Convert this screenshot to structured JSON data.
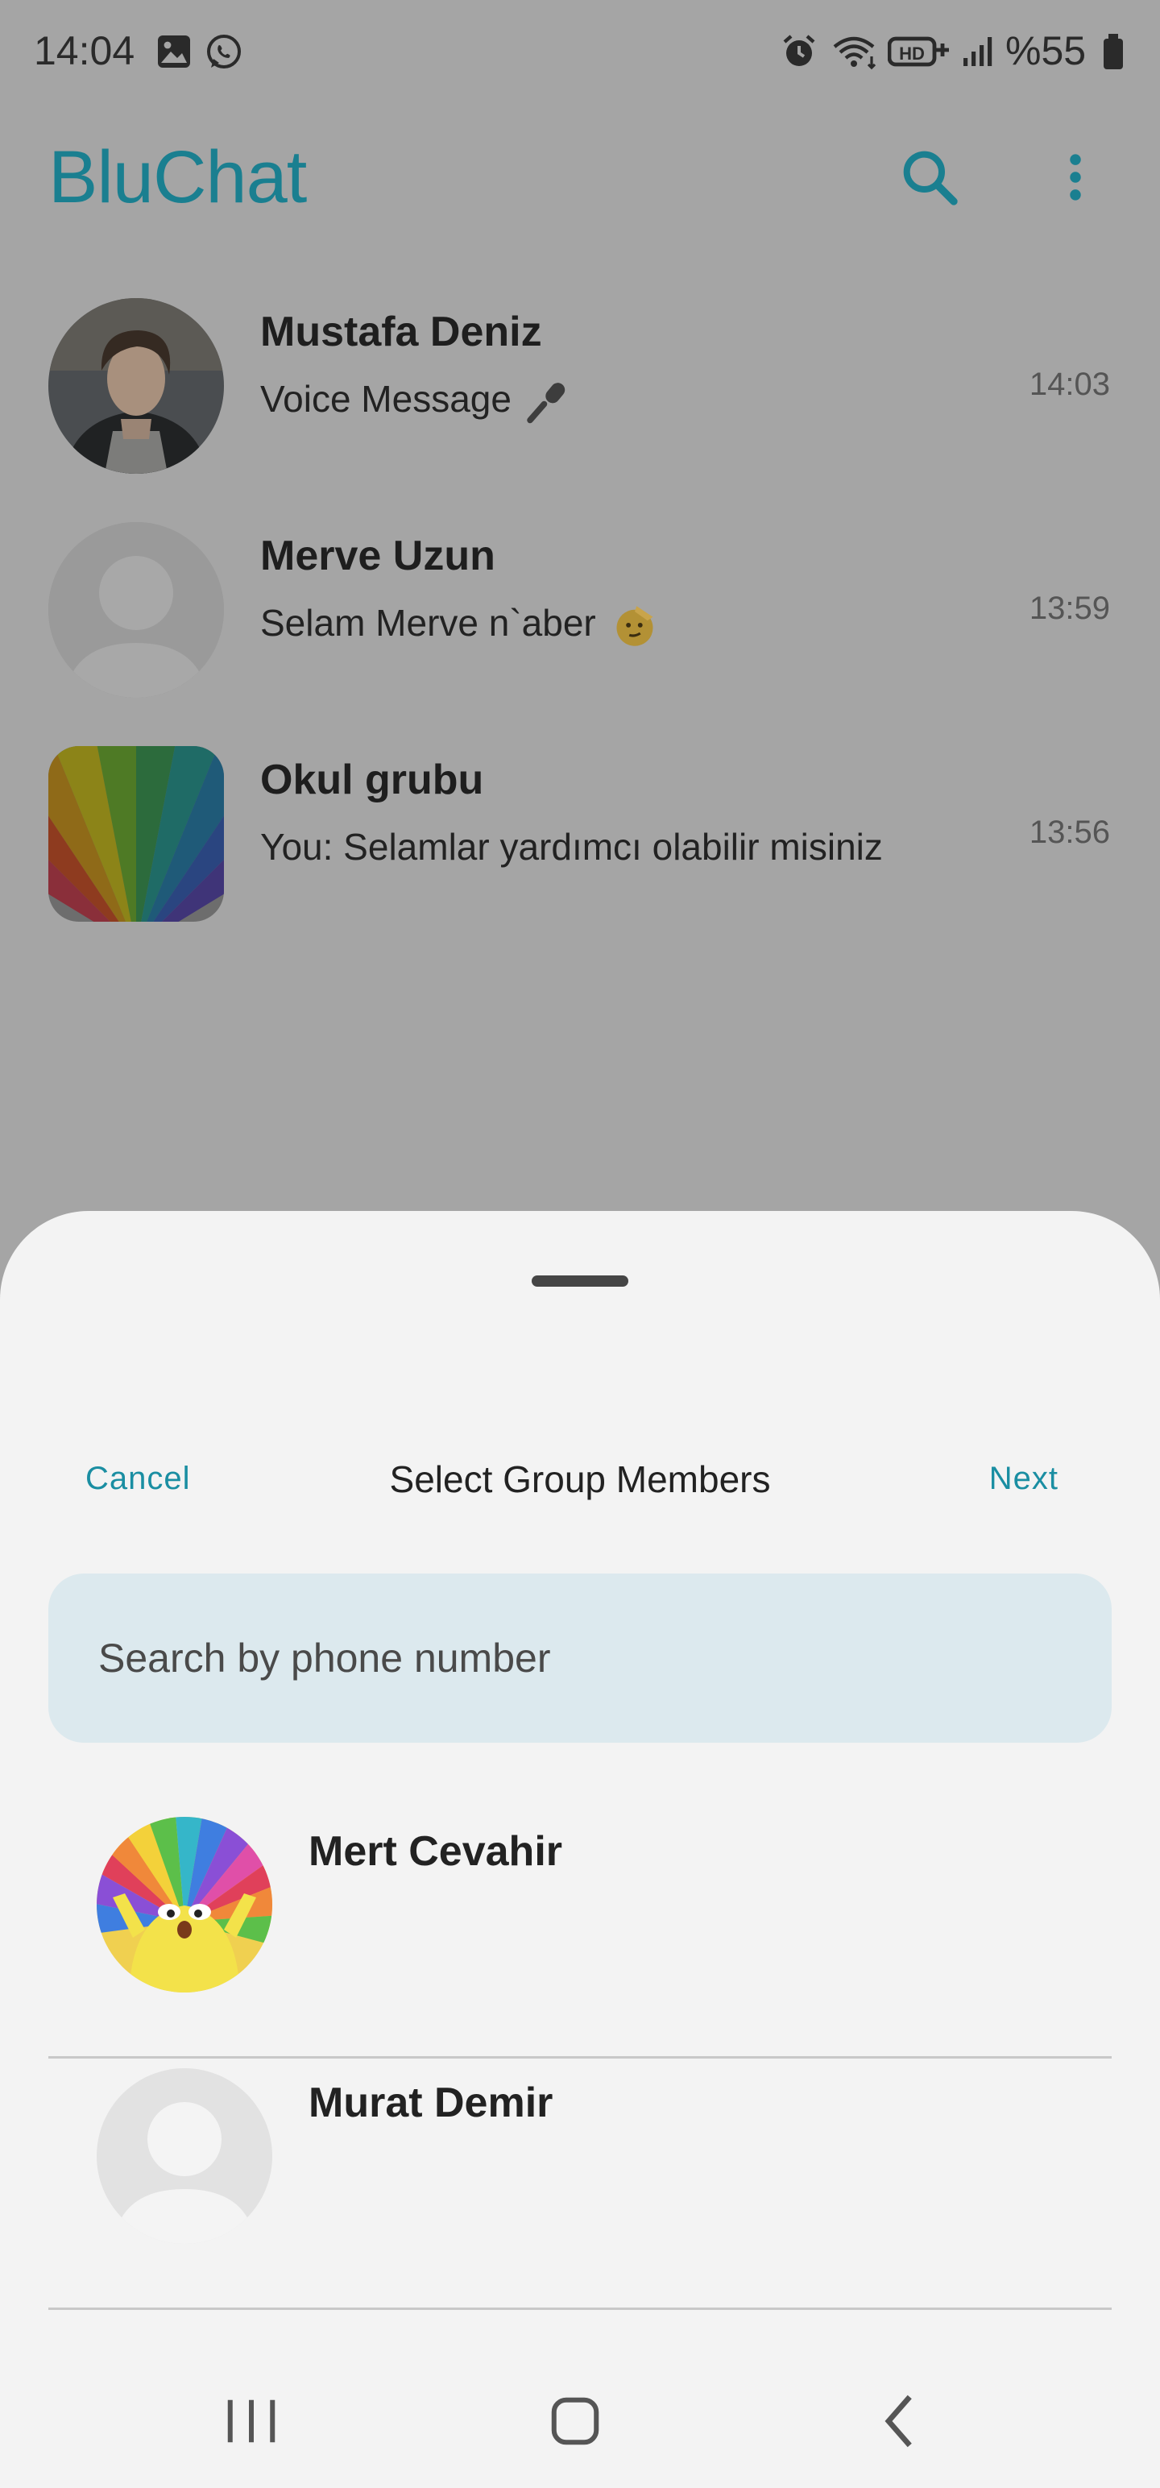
{
  "status_bar": {
    "time": "14:04",
    "battery_percent": "%55",
    "icons": [
      "gallery-icon",
      "whatsapp-icon",
      "alarm-icon",
      "wifi-icon",
      "hd-plus-icon",
      "signal-icon",
      "battery-icon"
    ]
  },
  "app": {
    "title": "BluChat",
    "accent_color": "#1a7f90",
    "actions": [
      "search-icon",
      "more-vert-icon"
    ]
  },
  "chats": [
    {
      "name": "Mustafa Deniz",
      "preview": "Voice Message",
      "preview_icon": "microphone-icon",
      "time": "14:03",
      "avatar": "photo-young-man"
    },
    {
      "name": "Merve Uzun",
      "preview": "Selam Merve n`aber",
      "preview_icon": "saluting-face-emoji",
      "time": "13:59",
      "avatar": "default-avatar"
    },
    {
      "name": "Okul grubu",
      "preview": "You: Selamlar yardımcı olabilir misiniz",
      "time": "13:56",
      "avatar": "color-swatch-fan"
    }
  ],
  "sheet": {
    "cancel_label": "Cancel",
    "title": "Select Group Members",
    "next_label": "Next",
    "search_placeholder": "Search by phone number",
    "link_color": "#1a8ea2",
    "contacts": [
      {
        "name": "Mert Cevahir",
        "avatar": "rainbow-cartoon-character"
      },
      {
        "name": "Murat Demir",
        "avatar": "default-avatar"
      }
    ]
  },
  "nav_bar": {
    "buttons": [
      "recent-apps-icon",
      "home-icon",
      "back-icon"
    ]
  }
}
